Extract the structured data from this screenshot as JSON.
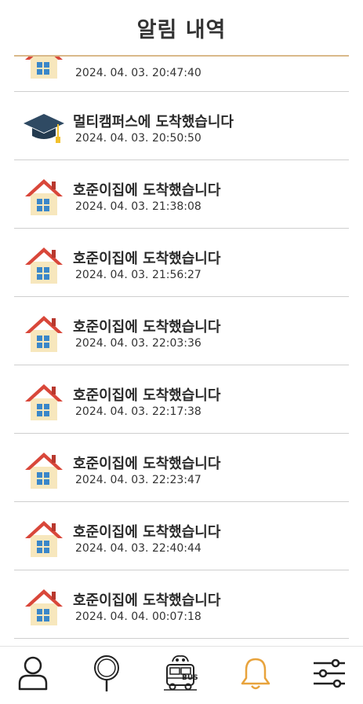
{
  "header": {
    "title": "알림 내역"
  },
  "notifications": [
    {
      "icon": "house-icon",
      "title": "",
      "time": "2024. 04. 03. 20:47:40"
    },
    {
      "icon": "graduation-cap-icon",
      "title": "멀티캠퍼스에 도착했습니다",
      "time": "2024. 04. 03. 20:50:50"
    },
    {
      "icon": "house-icon",
      "title": "호준이집에 도착했습니다",
      "time": "2024. 04. 03. 21:38:08"
    },
    {
      "icon": "house-icon",
      "title": "호준이집에 도착했습니다",
      "time": "2024. 04. 03. 21:56:27"
    },
    {
      "icon": "house-icon",
      "title": "호준이집에 도착했습니다",
      "time": "2024. 04. 03. 22:03:36"
    },
    {
      "icon": "house-icon",
      "title": "호준이집에 도착했습니다",
      "time": "2024. 04. 03. 22:17:38"
    },
    {
      "icon": "house-icon",
      "title": "호준이집에 도착했습니다",
      "time": "2024. 04. 03. 22:23:47"
    },
    {
      "icon": "house-icon",
      "title": "호준이집에 도착했습니다",
      "time": "2024. 04. 03. 22:40:44"
    },
    {
      "icon": "house-icon",
      "title": "호준이집에 도착했습니다",
      "time": "2024. 04. 04. 00:07:18"
    }
  ],
  "tabbar": {
    "bus_label": "BUS",
    "tabs": [
      {
        "icon": "person-icon",
        "active": false
      },
      {
        "icon": "bus-stop-icon",
        "active": false
      },
      {
        "icon": "bus-icon",
        "active": false
      },
      {
        "icon": "bell-icon",
        "active": true
      },
      {
        "icon": "settings-sliders-icon",
        "active": false
      }
    ]
  },
  "colors": {
    "accent": "#e8a33c",
    "divider": "#d9b98a",
    "house_roof": "#d9473a",
    "house_wall": "#f7e7bd",
    "window": "#3a87c9",
    "cap": "#2f4a63",
    "tassel": "#f2c12e"
  }
}
